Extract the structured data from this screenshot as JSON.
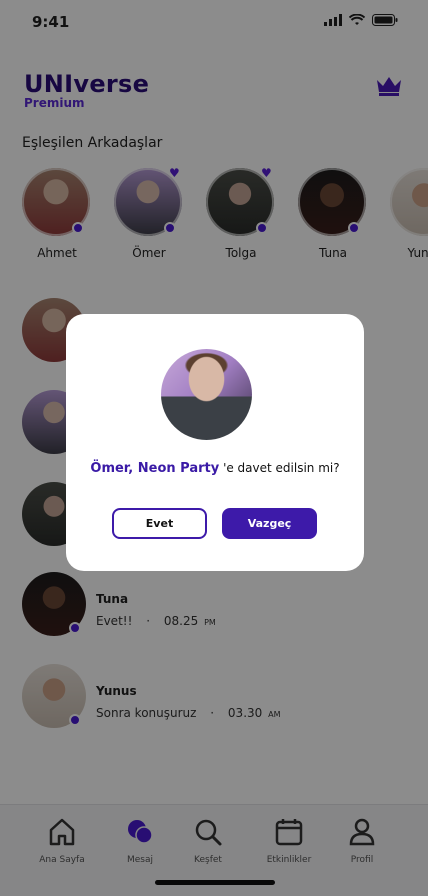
{
  "status_bar": {
    "time": "9:41"
  },
  "brand": {
    "title": "UNIverse",
    "subtitle": "Premium"
  },
  "friends_section": {
    "title": "Eşleşilen Arkadaşlar",
    "friends": [
      {
        "name": "Ahmet",
        "heart": false
      },
      {
        "name": "Ömer",
        "heart": true
      },
      {
        "name": "Tolga",
        "heart": true
      },
      {
        "name": "Tuna",
        "heart": false
      },
      {
        "name": "Yunus",
        "heart": false
      }
    ]
  },
  "chats": [
    {
      "name": "",
      "message": "",
      "time": "",
      "ampm": ""
    },
    {
      "name": "",
      "message": "",
      "time": "",
      "ampm": ""
    },
    {
      "name": "",
      "message": "",
      "time": "",
      "ampm": ""
    },
    {
      "name": "Tuna",
      "message": "Evet!!",
      "separator": "·",
      "time": "08.25",
      "ampm": "PM"
    },
    {
      "name": "Yunus",
      "message": "Sonra konuşuruz",
      "separator": "·",
      "time": "03.30",
      "ampm": "AM"
    }
  ],
  "tab_bar": {
    "tabs": [
      {
        "label": "Ana Sayfa",
        "icon": "home-icon"
      },
      {
        "label": "Mesaj",
        "icon": "chat-icon"
      },
      {
        "label": "Keşfet",
        "icon": "search-icon"
      },
      {
        "label": "Etkinlikler",
        "icon": "calendar-icon"
      },
      {
        "label": "Profil",
        "icon": "profile-icon"
      }
    ]
  },
  "modal": {
    "highlight": "Ömer, Neon Party",
    "question_rest": "'e davet edilsin mi?",
    "yes_label": "Evet",
    "cancel_label": "Vazgeç"
  },
  "colors": {
    "brand": "#2b0d78",
    "accent": "#3d1aa9",
    "dot": "#4a1bd1"
  }
}
